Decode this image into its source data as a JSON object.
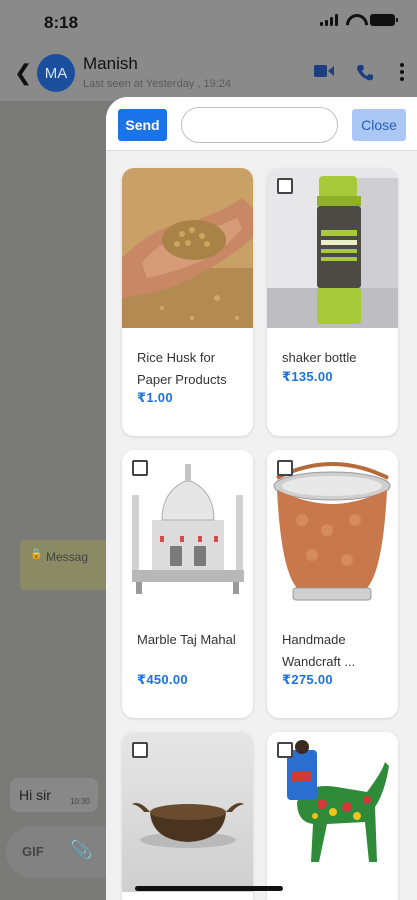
{
  "status_bar": {
    "time": "8:18"
  },
  "chat_header": {
    "avatar_initials": "MA",
    "contact_name": "Manish",
    "last_seen": "Last seen at Yesterday , 19:24",
    "icons": [
      "back-chevron-icon",
      "video-call-icon",
      "phone-icon",
      "more-vert-icon"
    ]
  },
  "chat": {
    "system_message": "Messag",
    "bubble_text": "Hi sir",
    "bubble_time": "10:30",
    "composer_gif": "GIF"
  },
  "picker": {
    "send_label": "Send",
    "search_value": "",
    "search_placeholder": "",
    "close_label": "Close",
    "products": [
      {
        "name": "Rice Husk for Paper Products",
        "price": "₹1.00",
        "checked": false
      },
      {
        "name": "shaker bottle",
        "price": "₹135.00",
        "checked": false
      },
      {
        "name": "Marble Taj Mahal",
        "price": "₹450.00",
        "checked": false
      },
      {
        "name": "Handmade Wandcraft ...",
        "price": "₹275.00",
        "checked": false
      },
      {
        "name": "",
        "price": "",
        "checked": false
      },
      {
        "name": "",
        "price": "",
        "checked": false
      }
    ]
  },
  "colors": {
    "accent": "#1a73e8",
    "close_bg": "#aac7f5",
    "overlay_bg": "#7a7a76"
  }
}
